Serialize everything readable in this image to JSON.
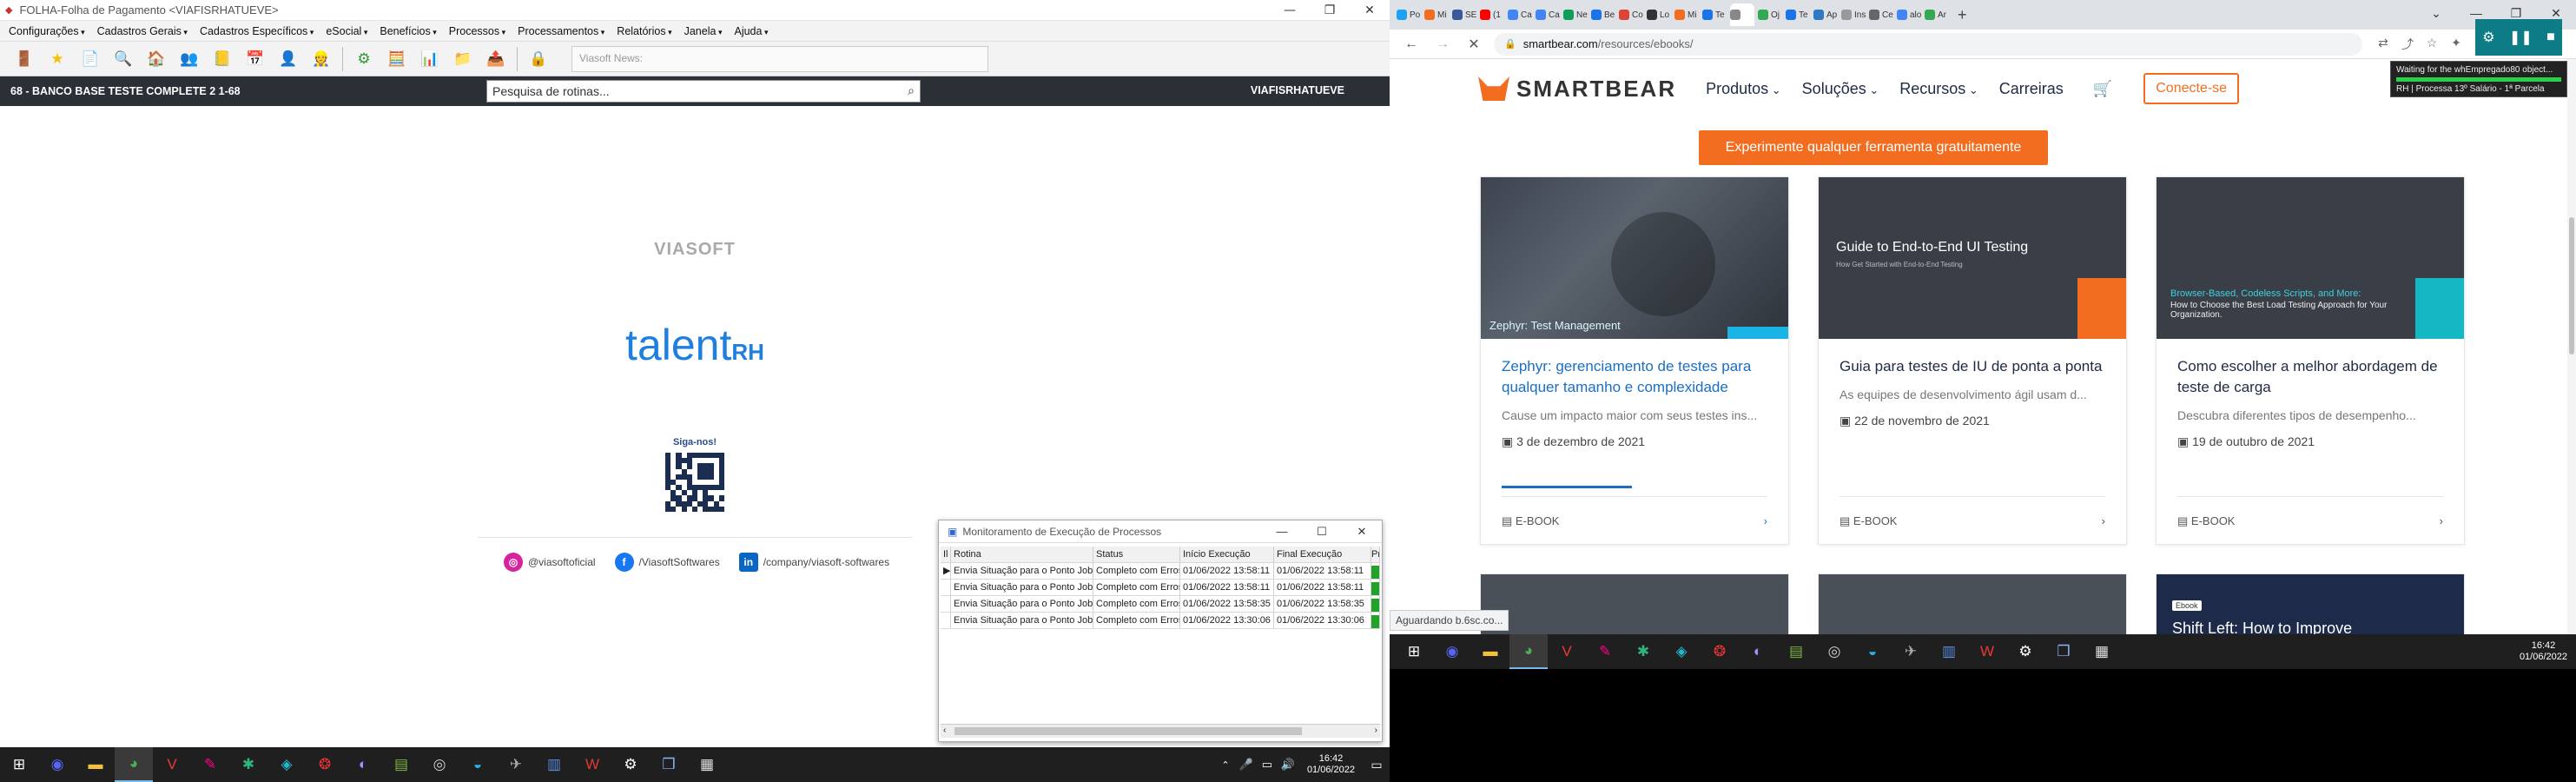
{
  "left_window": {
    "title": "FOLHA-Folha de Pagamento <VIAFISRHATUEVE>",
    "menu": [
      "Configurações",
      "Cadastros Gerais",
      "Cadastros Específicos",
      "eSocial",
      "Benefícios",
      "Processos",
      "Processamentos",
      "Relatórios",
      "Janela",
      "Ajuda"
    ],
    "news_label": "Viasoft News:",
    "company_label": "68 - BANCO BASE TESTE COMPLETE 2 1-68",
    "search_placeholder": "Pesquisa de rotinas...",
    "user_label": "VIAFISRHATUEVE",
    "brand_top": "VIASOFT",
    "brand_main": "talent",
    "brand_suffix": "RH",
    "follow_label": "Siga-nos!",
    "socials": [
      {
        "icon": "instagram-icon",
        "label": "@viasoftoficial",
        "color": "#d6249f"
      },
      {
        "icon": "facebook-icon",
        "label": "/ViasoftSoftwares",
        "color": "#1877f2"
      },
      {
        "icon": "linkedin-icon",
        "label": "/company/viasoft-softwares",
        "color": "#0a66c2"
      }
    ]
  },
  "monitor": {
    "title": "Monitoramento de Execução de Processos",
    "columns": [
      "",
      "Rotina",
      "Status",
      "Início Execução",
      "Final Execução",
      "Pr"
    ],
    "rows": [
      {
        "rotina": "Envia Situação para o Ponto Job",
        "status": "Completo com Erros",
        "inicio": "01/06/2022 13:58:11",
        "final": "01/06/2022 13:58:11",
        "progress": 1
      },
      {
        "rotina": "Envia Situação para o Ponto Job",
        "status": "Completo com Erros",
        "inicio": "01/06/2022 13:58:11",
        "final": "01/06/2022 13:58:11",
        "progress": 1
      },
      {
        "rotina": "Envia Situação para o Ponto Job",
        "status": "Completo com Erros",
        "inicio": "01/06/2022 13:58:35",
        "final": "01/06/2022 13:58:35",
        "progress": 1
      },
      {
        "rotina": "Envia Situação para o Ponto Job",
        "status": "Completo com Erros",
        "inicio": "01/06/2022 13:30:06",
        "final": "01/06/2022 13:30:06",
        "progress": 1
      }
    ]
  },
  "left_taskbar": {
    "time": "16:42",
    "date": "01/06/2022"
  },
  "browser": {
    "url_host": "smartbear.com",
    "url_path": "/resources/ebooks/",
    "tabs": [
      {
        "label": "Po",
        "color": "#1da1f2"
      },
      {
        "label": "Mi",
        "color": "#f36d21"
      },
      {
        "label": "SE",
        "color": "#3b5998"
      },
      {
        "label": "(1",
        "color": "#ff0000"
      },
      {
        "label": "Ca",
        "color": "#4285f4"
      },
      {
        "label": "Ca",
        "color": "#4285f4"
      },
      {
        "label": "Ne",
        "color": "#0f9d58"
      },
      {
        "label": "Be",
        "color": "#1a73e8"
      },
      {
        "label": "Co",
        "color": "#db4437"
      },
      {
        "label": "Lo",
        "color": "#333333"
      },
      {
        "label": "Mi",
        "color": "#f36d21"
      },
      {
        "label": "Te",
        "color": "#1a73e8"
      },
      {
        "label": "",
        "color": "#888888"
      },
      {
        "label": "Oj",
        "color": "#34a853"
      },
      {
        "label": "Te",
        "color": "#1a73e8"
      },
      {
        "label": "Ap",
        "color": "#2f78c4"
      },
      {
        "label": "Ins",
        "color": "#999999"
      },
      {
        "label": "Ce",
        "color": "#666666"
      },
      {
        "label": "alo",
        "color": "#4285f4"
      },
      {
        "label": "Ar",
        "color": "#34a853"
      }
    ],
    "status_text": "Aguardando b.6sc.co...",
    "tooltip_line1": "Waiting for the whEmpregado80 object...",
    "tooltip_line2": "RH | Processa 13º Salário - 1ª Parcela"
  },
  "smartbear": {
    "logo": "SMARTBEAR",
    "nav": [
      "Produtos",
      "Soluções",
      "Recursos",
      "Carreiras"
    ],
    "cta": "Conecte-se",
    "orange_button": "Experimente qualquer ferramenta gratuitamente",
    "cards": [
      {
        "title": "Zephyr: gerenciamento de testes para qualquer tamanho e complexidade",
        "desc": "Cause um impacto maior com seus testes ins...",
        "date": "3 de dezembro de 2021",
        "type": "E-BOOK",
        "img_caption": "Zephyr: Test Management",
        "highlight": true
      },
      {
        "title": "Guia para testes de IU de ponta a ponta",
        "desc": "As equipes de desenvolvimento ágil usam d...",
        "date": "22 de novembro de 2021",
        "type": "E-BOOK",
        "img_caption": "Guide to End-to-End UI Testing",
        "img_sub": "How Get Started with End-to-End Testing",
        "highlight": false
      },
      {
        "title": "Como escolher a melhor abordagem de teste de carga",
        "desc": "Descubra diferentes tipos de desempenho...",
        "date": "19 de outubro de 2021",
        "type": "E-BOOK",
        "img_caption": "Browser-Based, Codeless Scripts, and More:",
        "img_sub": "How to Choose the Best Load Testing Approach for Your Organization.",
        "highlight": false
      }
    ],
    "bottom_card_badge": "Ebook",
    "bottom_card_title": "Shift Left: How to Improve"
  },
  "right_taskbar": {
    "time": "16:42",
    "date": "01/06/2022"
  }
}
